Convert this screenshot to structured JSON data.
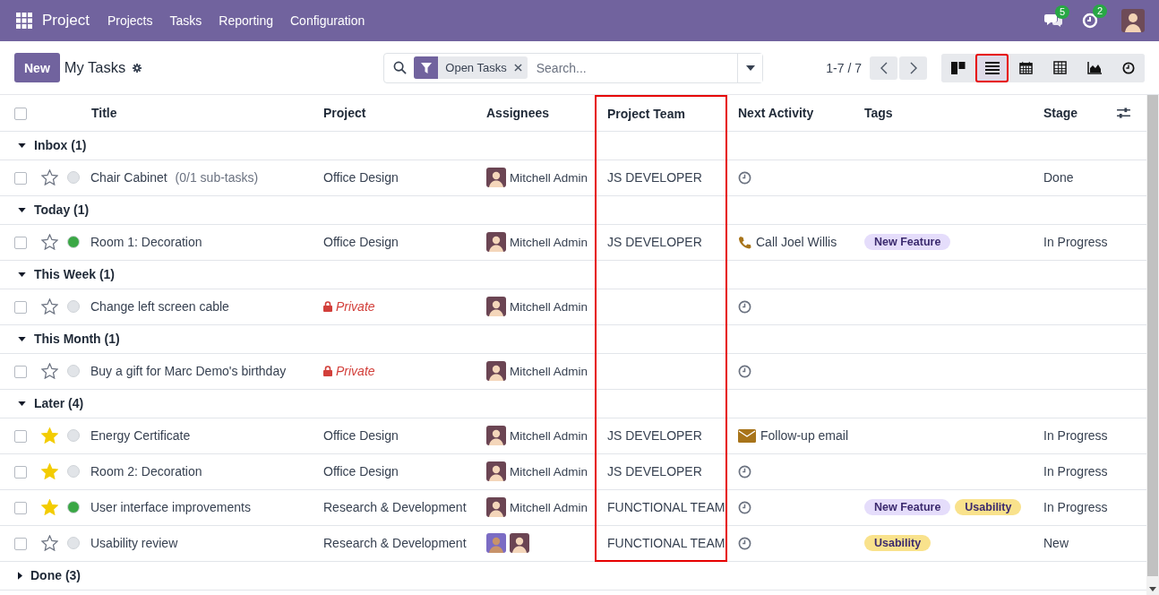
{
  "navbar": {
    "app": "Project",
    "menu": [
      "Projects",
      "Tasks",
      "Reporting",
      "Configuration"
    ],
    "messages_badge": "5",
    "activities_badge": "2"
  },
  "control_panel": {
    "new_button": "New",
    "title": "My Tasks",
    "search": {
      "facet": "Open Tasks",
      "placeholder": "Search..."
    },
    "pager": "1-7 / 7",
    "views": [
      {
        "kind": "kanban",
        "selected": false,
        "highlighted": false
      },
      {
        "kind": "list",
        "selected": true,
        "highlighted": true
      },
      {
        "kind": "calendar",
        "selected": false,
        "highlighted": false
      },
      {
        "kind": "pivot",
        "selected": false,
        "highlighted": false
      },
      {
        "kind": "graph",
        "selected": false,
        "highlighted": false
      },
      {
        "kind": "activity",
        "selected": false,
        "highlighted": false
      }
    ]
  },
  "table": {
    "select_all_checked": false,
    "columns": [
      {
        "label": "Title",
        "highlighted": false
      },
      {
        "label": "Project",
        "highlighted": false
      },
      {
        "label": "Assignees",
        "highlighted": false
      },
      {
        "label": "Project Team",
        "highlighted": true
      },
      {
        "label": "Next Activity",
        "highlighted": false
      },
      {
        "label": "Tags",
        "highlighted": false
      },
      {
        "label": "Stage",
        "highlighted": false
      }
    ],
    "groups": [
      {
        "label": "Inbox (1)",
        "expanded": true,
        "tasks": [
          {
            "title": "Chair Cabinet",
            "subtasks": "(0/1 sub-tasks)",
            "checked": false,
            "starred": false,
            "color": "#e1e4e8",
            "project": {
              "name": "Office Design",
              "private": false
            },
            "assignees": [
              {
                "kind": "admin"
              }
            ],
            "assignee_name": "Mitchell Admin",
            "team": "JS DEVELOPER",
            "activity": {
              "kind": "clock"
            },
            "stage": "Done"
          }
        ]
      },
      {
        "label": "Today (1)",
        "expanded": true,
        "tasks": [
          {
            "title": "Room 1: Decoration",
            "checked": false,
            "starred": false,
            "color": "#3aa745",
            "project": {
              "name": "Office Design",
              "private": false
            },
            "assignees": [
              {
                "kind": "admin"
              }
            ],
            "assignee_name": "Mitchell Admin",
            "team": "JS DEVELOPER",
            "activity": {
              "kind": "phone",
              "label": "Call Joel Willis"
            },
            "tags": [
              {
                "label": "New Feature",
                "color": "#e5ddfb"
              }
            ],
            "stage": "In Progress"
          }
        ]
      },
      {
        "label": "This Week (1)",
        "expanded": true,
        "tasks": [
          {
            "title": "Change left screen cable",
            "checked": false,
            "starred": false,
            "color": "#e1e4e8",
            "project": {
              "name": "Private",
              "private": true
            },
            "assignees": [
              {
                "kind": "admin"
              }
            ],
            "assignee_name": "Mitchell Admin",
            "activity": {
              "kind": "clock"
            }
          }
        ]
      },
      {
        "label": "This Month (1)",
        "expanded": true,
        "tasks": [
          {
            "title": "Buy a gift for Marc Demo's birthday",
            "checked": false,
            "starred": false,
            "color": "#e1e4e8",
            "project": {
              "name": "Private",
              "private": true
            },
            "assignees": [
              {
                "kind": "admin"
              }
            ],
            "assignee_name": "Mitchell Admin",
            "activity": {
              "kind": "clock"
            }
          }
        ]
      },
      {
        "label": "Later (4)",
        "expanded": true,
        "tasks": [
          {
            "title": "Energy Certificate",
            "checked": false,
            "starred": true,
            "color": "#e1e4e8",
            "project": {
              "name": "Office Design",
              "private": false
            },
            "assignees": [
              {
                "kind": "admin"
              }
            ],
            "assignee_name": "Mitchell Admin",
            "team": "JS DEVELOPER",
            "activity": {
              "kind": "email",
              "label": "Follow-up email"
            },
            "stage": "In Progress"
          },
          {
            "title": "Room 2: Decoration",
            "checked": false,
            "starred": true,
            "color": "#e1e4e8",
            "project": {
              "name": "Office Design",
              "private": false
            },
            "assignees": [
              {
                "kind": "admin"
              }
            ],
            "assignee_name": "Mitchell Admin",
            "team": "JS DEVELOPER",
            "activity": {
              "kind": "clock"
            },
            "stage": "In Progress"
          },
          {
            "title": "User interface improvements",
            "checked": false,
            "starred": true,
            "color": "#3aa745",
            "project": {
              "name": "Research & Development",
              "private": false
            },
            "assignees": [
              {
                "kind": "admin"
              }
            ],
            "assignee_name": "Mitchell Admin",
            "team": "FUNCTIONAL TEAM",
            "activity": {
              "kind": "clock"
            },
            "tags": [
              {
                "label": "New Feature",
                "color": "#e5ddfb"
              },
              {
                "label": "Usability",
                "color": "#f9e28c"
              }
            ],
            "stage": "In Progress"
          },
          {
            "title": "Usability review",
            "checked": false,
            "starred": false,
            "color": "#e1e4e8",
            "project": {
              "name": "Research & Development",
              "private": false
            },
            "assignees": [
              {
                "kind": "user"
              },
              {
                "kind": "admin"
              }
            ],
            "team": "FUNCTIONAL TEAM",
            "activity": {
              "kind": "clock"
            },
            "tags": [
              {
                "label": "Usability",
                "color": "#f9e28c"
              }
            ],
            "stage": "New"
          }
        ]
      },
      {
        "label": "Done (3)",
        "expanded": false
      }
    ]
  }
}
